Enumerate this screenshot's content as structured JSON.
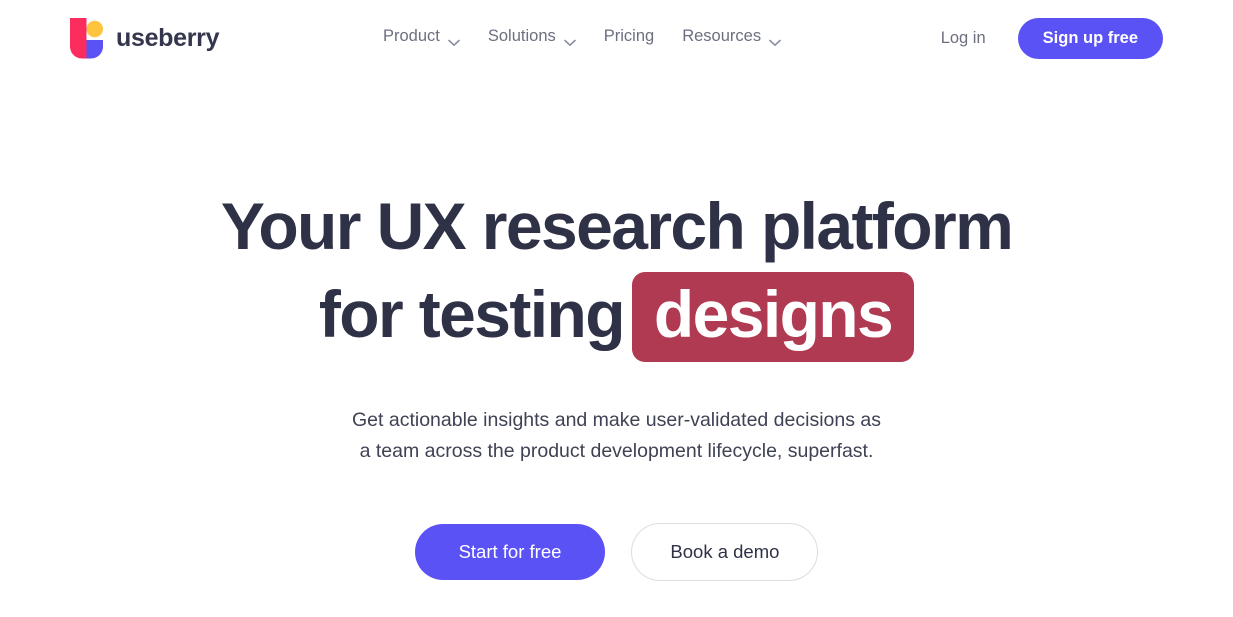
{
  "brand": {
    "name": "useberry",
    "logo_icon": "useberry-u-logo-icon",
    "colors": {
      "logo_pink": "#fb2d5e",
      "logo_yellow": "#ffc43d",
      "logo_blue": "#5b52f5"
    }
  },
  "header": {
    "nav": [
      {
        "label": "Product",
        "has_dropdown": true,
        "icon": "chevron-down-icon"
      },
      {
        "label": "Solutions",
        "has_dropdown": true,
        "icon": "chevron-down-icon"
      },
      {
        "label": "Pricing",
        "has_dropdown": false,
        "icon": ""
      },
      {
        "label": "Resources",
        "has_dropdown": true,
        "icon": "chevron-down-icon"
      }
    ],
    "login_label": "Log in",
    "signup_label": "Sign up free"
  },
  "hero": {
    "headline_line1": "Your UX research platform",
    "headline_line2_prefix": "for testing",
    "headline_highlight": "designs",
    "subtitle_line1": "Get actionable insights and make user-validated decisions as",
    "subtitle_line2": "a team across the product development lifecycle, superfast.",
    "primary_cta": "Start for free",
    "secondary_cta": "Book a demo"
  },
  "colors": {
    "accent_purple": "#5b52f5",
    "highlight_crimson": "#b03a52",
    "heading_navy": "#2f3247",
    "muted_gray": "#6b6f80",
    "border_gray": "#dddde1",
    "page_background": "#ffffff"
  }
}
